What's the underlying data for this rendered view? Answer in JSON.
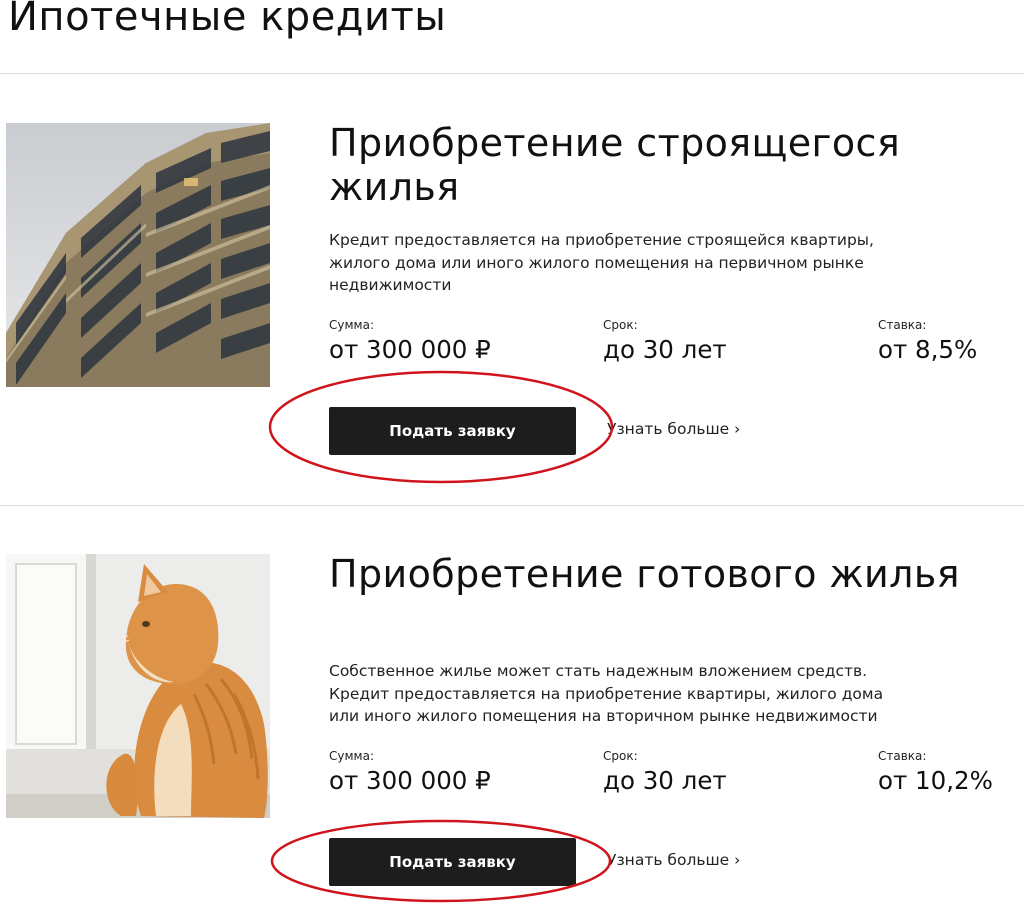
{
  "page": {
    "title": "Ипотечные кредиты"
  },
  "offers": [
    {
      "title": "Приобретение строящегося жилья",
      "image_icon": "apartment-building-photo",
      "description": "Кредит предоставляется на приобретение строящейся квартиры, жилого дома или иного жилого помещения на первичном рынке недвижимости",
      "sum_label": "Сумма:",
      "sum_value": "от 300 000 ₽",
      "term_label": "Срок:",
      "term_value": "до 30 лет",
      "rate_label": "Ставка:",
      "rate_value": "от 8,5%",
      "apply_label": "Подать заявку",
      "more_label": "Узнать больше ›"
    },
    {
      "title": "Приобретение готового жилья",
      "image_icon": "ginger-cat-photo",
      "description": "Собственное жилье может стать надежным вложением средств. Кредит предоставляется на приобретение квартиры, жилого дома или иного жилого помещения на вторичном рынке недвижимости",
      "sum_label": "Сумма:",
      "sum_value": "от 300 000 ₽",
      "term_label": "Срок:",
      "term_value": "до 30 лет",
      "rate_label": "Ставка:",
      "rate_value": "от 10,2%",
      "apply_label": "Подать заявку",
      "more_label": "Узнать больше ›"
    }
  ],
  "annotation": {
    "color": "#d0141c"
  }
}
